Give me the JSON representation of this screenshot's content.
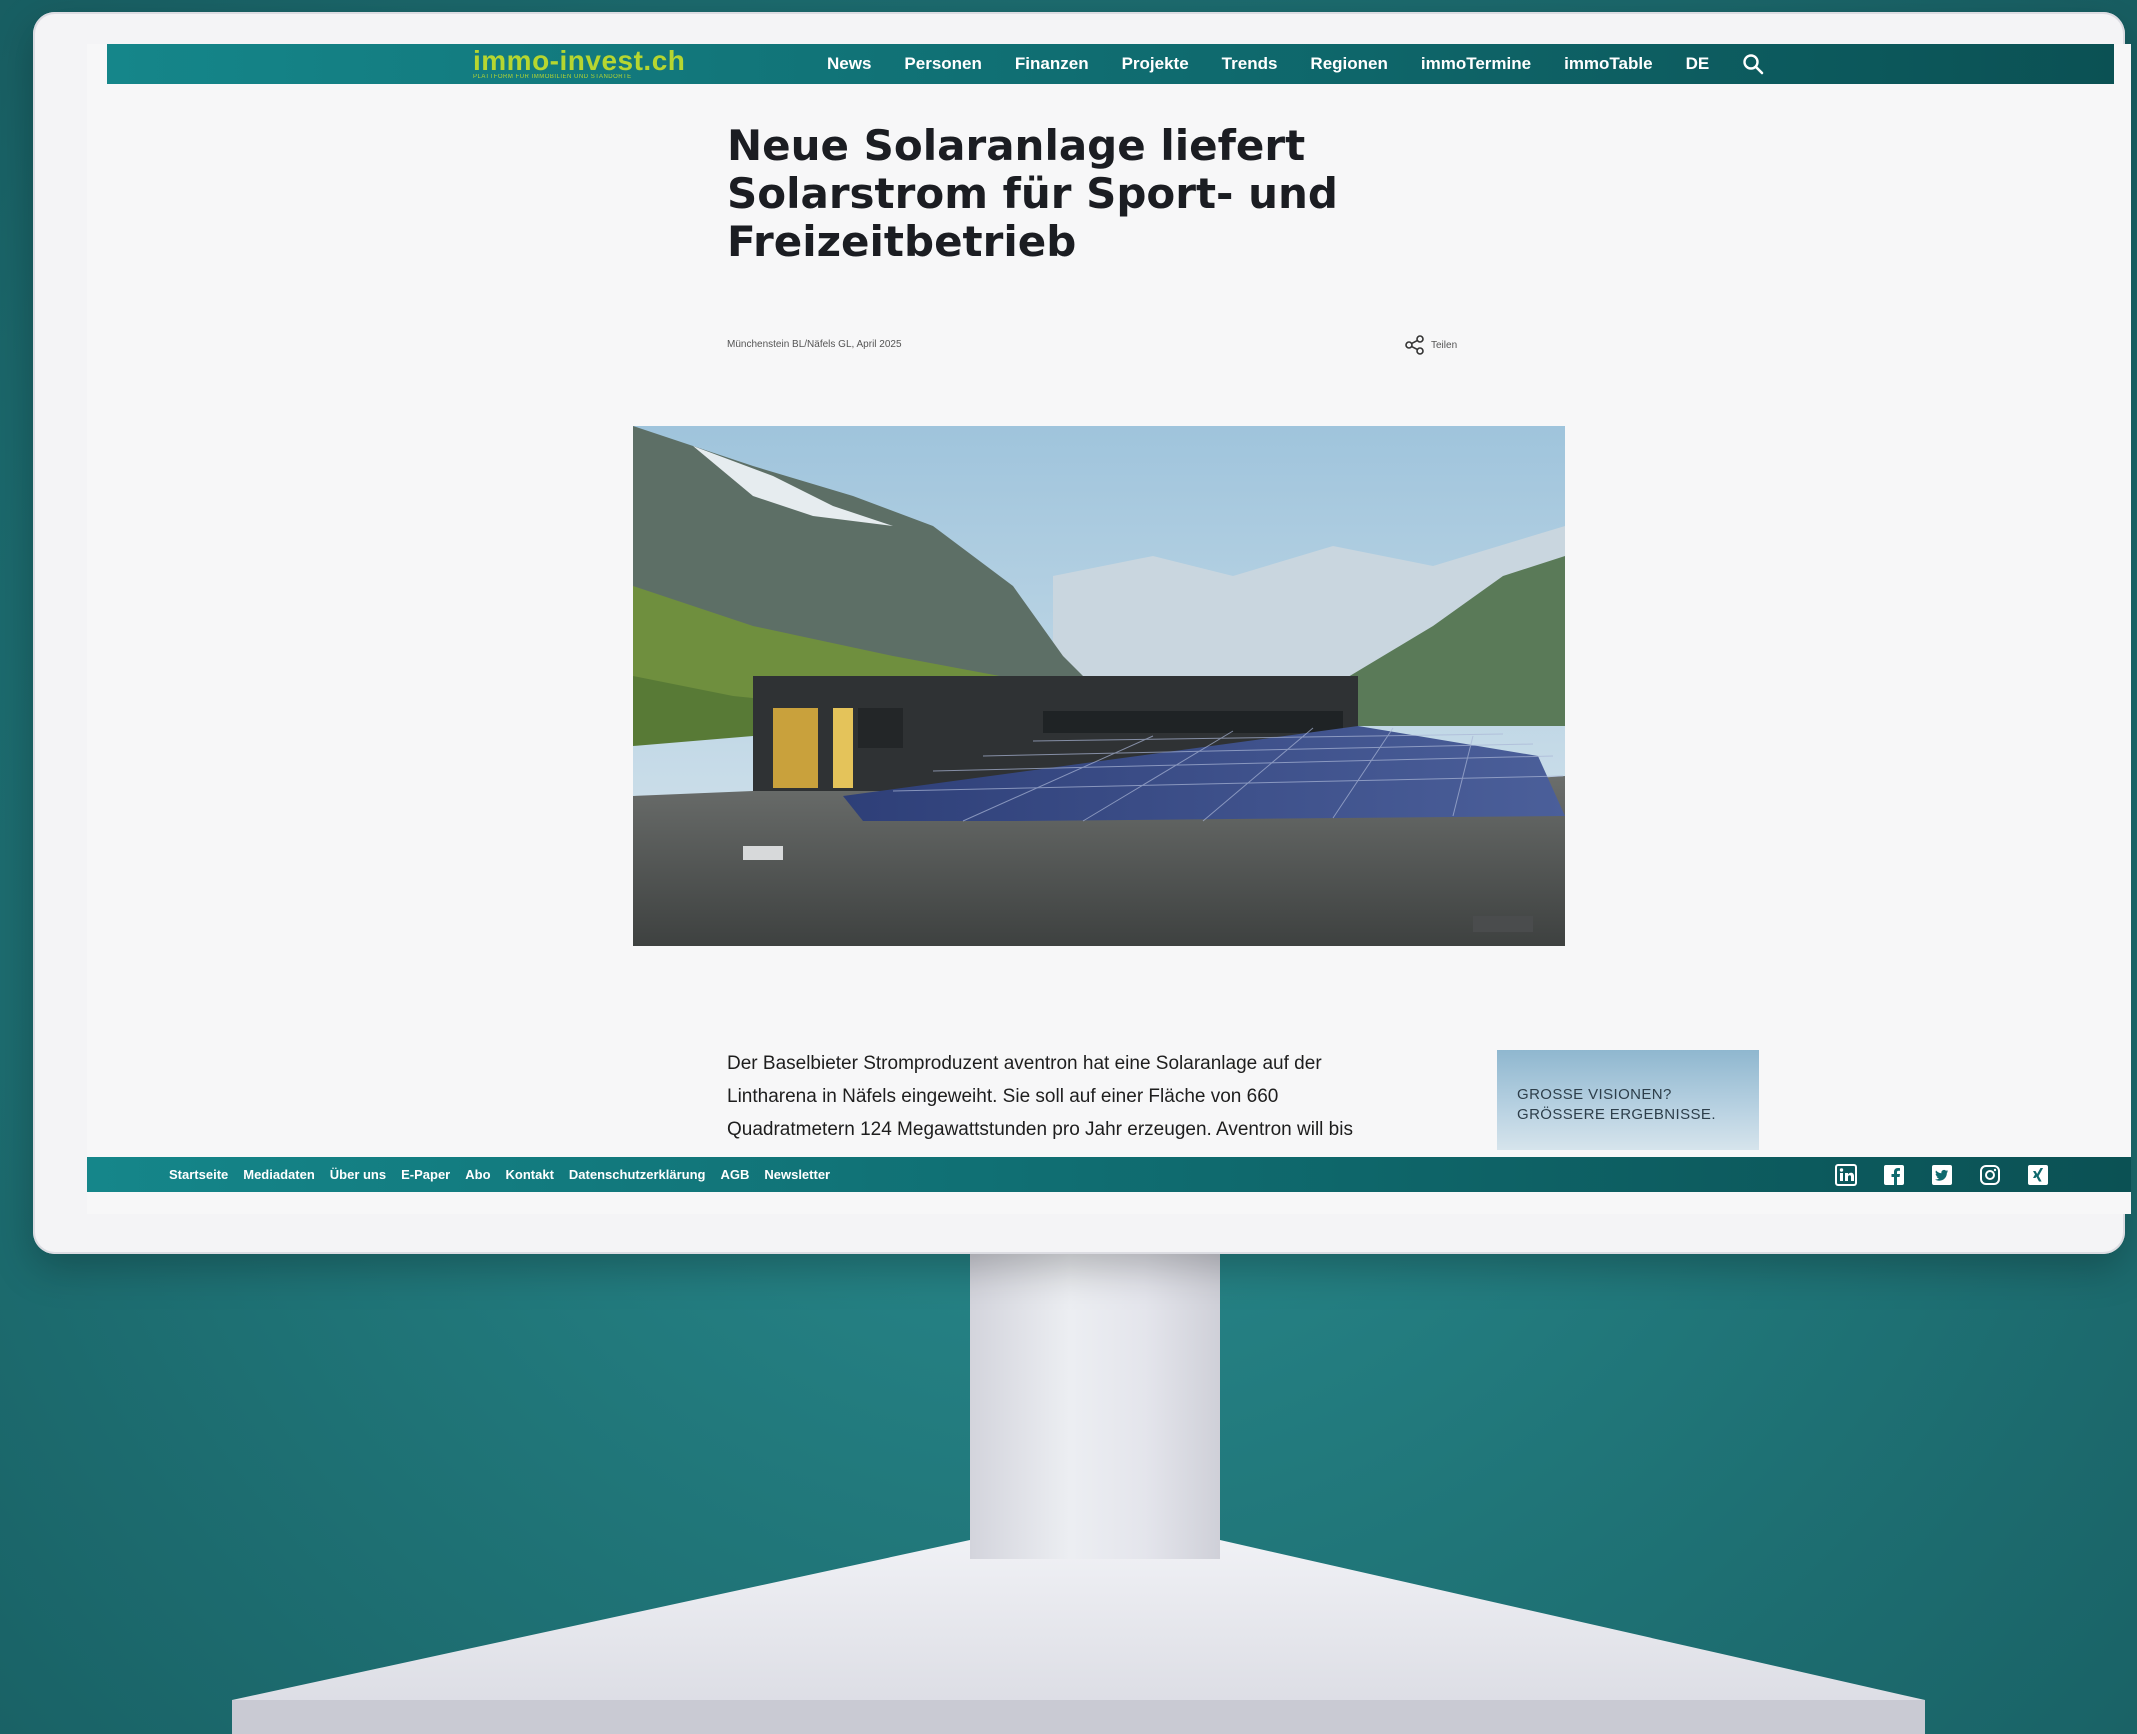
{
  "site": {
    "logo": "immo-invest.ch",
    "tagline": "PLATTFORM FÜR IMMOBILIEN UND STANDORTE"
  },
  "nav": {
    "items": [
      "News",
      "Personen",
      "Finanzen",
      "Projekte",
      "Trends",
      "Regionen",
      "immoTermine",
      "immoTable",
      "DE"
    ],
    "search_icon": "search-icon"
  },
  "article": {
    "title": "Neue Solaranlage liefert Solarstrom für Sport- und Freizeitbetrieb",
    "meta": "Münchenstein BL/Näfels GL, April 2025",
    "share_label": "Teilen",
    "body": [
      "Der Baselbieter Stromproduzent aventron hat eine Solaranlage auf der",
      "Lintharena in Näfels eingeweiht. Sie soll auf einer Fläche von 660",
      "Quadratmetern 124 Megawattstunden pro Jahr erzeugen. Aventron will bis"
    ]
  },
  "ad": {
    "line1": "GROSSE VISIONEN?",
    "line2": "GRÖSSERE ERGEBNISSE."
  },
  "footer": {
    "links": [
      "Startseite",
      "Mediadaten",
      "Über uns",
      "E-Paper",
      "Abo",
      "Kontakt",
      "Datenschutzerklärung",
      "AGB",
      "Newsletter"
    ],
    "social": [
      "linkedin-icon",
      "facebook-icon",
      "twitter-icon",
      "instagram-icon",
      "xing-icon"
    ]
  },
  "colors": {
    "background": "#1f7376",
    "bar": "#0f6a6e",
    "logo": "#b6d630",
    "headline": "#1b1d22"
  }
}
